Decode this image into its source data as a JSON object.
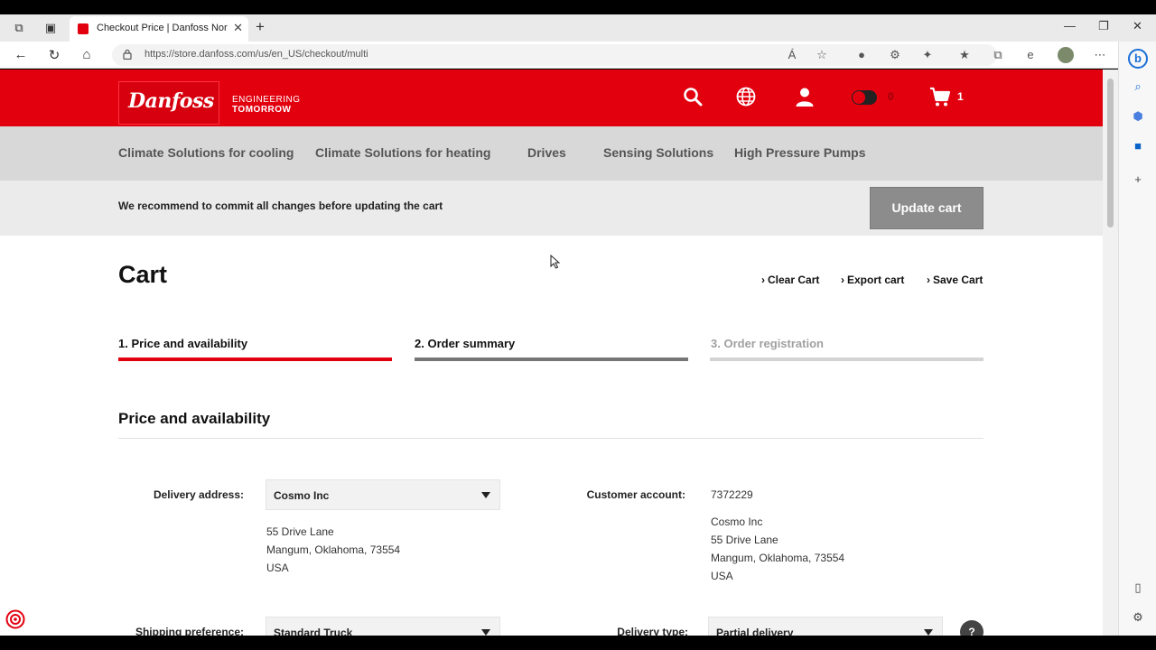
{
  "browser": {
    "tab_title": "Checkout Price | Danfoss North America",
    "url": "https://store.danfoss.com/us/en_US/checkout/multi",
    "colors": {
      "brand_red": "#e2000f"
    }
  },
  "header": {
    "logo_text": "Danfoss",
    "tagline_line1": "ENGINEERING",
    "tagline_line2": "TOMORROW",
    "compare_count": "0",
    "cart_count": "1",
    "icons": [
      "search-icon",
      "globe-icon",
      "user-icon",
      "toggle-icon",
      "cart-icon"
    ]
  },
  "nav": {
    "items": [
      "Climate Solutions for cooling",
      "Climate Solutions for heating",
      "Drives",
      "Sensing Solutions",
      "High Pressure Pumps"
    ]
  },
  "notice": {
    "text": "We recommend to commit all changes before updating the cart",
    "update_button": "Update cart"
  },
  "cart": {
    "title": "Cart",
    "links": [
      "Clear Cart",
      "Export cart",
      "Save Cart"
    ],
    "steps": [
      {
        "label": "1. Price and availability",
        "state": "active"
      },
      {
        "label": "2. Order summary",
        "state": "next"
      },
      {
        "label": "3. Order registration",
        "state": "disabled"
      }
    ]
  },
  "price_availability": {
    "title": "Price and availability",
    "delivery_address_label": "Delivery address:",
    "delivery_address_value": "Cosmo Inc",
    "delivery_address_lines": [
      "55 Drive Lane",
      "Mangum, Oklahoma, 73554",
      "USA"
    ],
    "customer_account_label": "Customer account:",
    "customer_account_value": "7372229",
    "customer_lines": [
      "Cosmo Inc",
      "55 Drive Lane",
      "Mangum, Oklahoma, 73554",
      "USA"
    ],
    "shipping_label": "Shipping preference:",
    "shipping_value": "Standard Truck",
    "delivery_type_label": "Delivery type:",
    "delivery_type_value": "Partial delivery",
    "help_label": "?"
  }
}
